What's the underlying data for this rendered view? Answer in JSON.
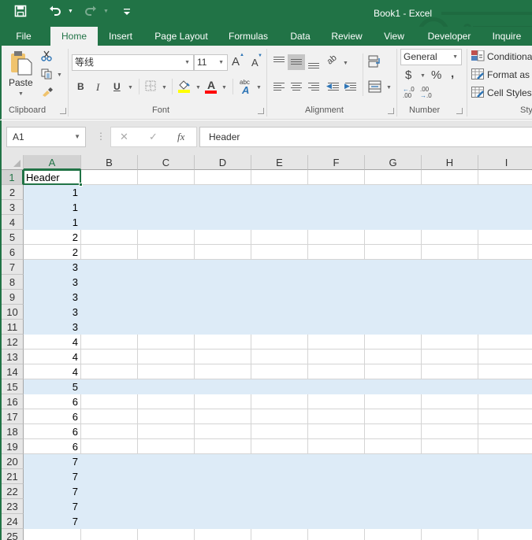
{
  "titlebar": {
    "title": "Book1 - Excel",
    "qat": [
      {
        "name": "save-icon",
        "glyph": "💾"
      },
      {
        "name": "undo-icon",
        "glyph": "↶"
      },
      {
        "name": "redo-icon",
        "glyph": "↷"
      },
      {
        "name": "customize-qat-icon",
        "glyph": "≡"
      }
    ]
  },
  "tabs": [
    {
      "label": "File",
      "active": false
    },
    {
      "label": "Home",
      "active": true
    },
    {
      "label": "Insert",
      "active": false
    },
    {
      "label": "Page Layout",
      "active": false
    },
    {
      "label": "Formulas",
      "active": false
    },
    {
      "label": "Data",
      "active": false
    },
    {
      "label": "Review",
      "active": false
    },
    {
      "label": "View",
      "active": false
    },
    {
      "label": "Developer",
      "active": false
    },
    {
      "label": "Inquire",
      "active": false
    }
  ],
  "ribbon": {
    "clipboard": {
      "label": "Clipboard",
      "paste_label": "Paste",
      "cut_icon": "scissors-icon",
      "copy_icon": "copy-icon",
      "format_painter_icon": "format-painter-icon"
    },
    "font": {
      "label": "Font",
      "font_name": "等线",
      "font_size": "11",
      "grow_label": "A",
      "shrink_label": "A",
      "bold": "B",
      "italic": "I",
      "underline": "U",
      "fill_color": "#ffff00",
      "font_color": "#ff0000",
      "font_color_label": "A",
      "phonetic_label": "abc"
    },
    "alignment": {
      "label": "Alignment",
      "middle_align_active": true
    },
    "number": {
      "label": "Number",
      "format": "General",
      "currency": "$",
      "percent": "%",
      "comma": ",",
      "increase_decimal": "←.0 .00",
      "decrease_decimal": ".00 →.0"
    },
    "styles": {
      "label": "Sty",
      "conditional": "Conditiona",
      "format_as_table": "Format as T",
      "cell_styles": "Cell Styles"
    }
  },
  "formula_bar": {
    "name_box": "A1",
    "cancel": "✕",
    "enter": "✓",
    "fx": "fx",
    "value": "Header"
  },
  "sheet": {
    "columns": [
      "A",
      "B",
      "C",
      "D",
      "E",
      "F",
      "G",
      "H",
      "I"
    ],
    "selected_column": "A",
    "selected_row": 1,
    "active_cell": "A1",
    "shade_color": "#ddebf7",
    "rows": [
      {
        "n": "1",
        "a": "Header",
        "shaded": false
      },
      {
        "n": "2",
        "a": "1",
        "shaded": true
      },
      {
        "n": "3",
        "a": "1",
        "shaded": true
      },
      {
        "n": "4",
        "a": "1",
        "shaded": true
      },
      {
        "n": "5",
        "a": "2",
        "shaded": false
      },
      {
        "n": "6",
        "a": "2",
        "shaded": false
      },
      {
        "n": "7",
        "a": "3",
        "shaded": true
      },
      {
        "n": "8",
        "a": "3",
        "shaded": true
      },
      {
        "n": "9",
        "a": "3",
        "shaded": true
      },
      {
        "n": "10",
        "a": "3",
        "shaded": true
      },
      {
        "n": "11",
        "a": "3",
        "shaded": true
      },
      {
        "n": "12",
        "a": "4",
        "shaded": false
      },
      {
        "n": "13",
        "a": "4",
        "shaded": false
      },
      {
        "n": "14",
        "a": "4",
        "shaded": false
      },
      {
        "n": "15",
        "a": "5",
        "shaded": true
      },
      {
        "n": "16",
        "a": "6",
        "shaded": false
      },
      {
        "n": "17",
        "a": "6",
        "shaded": false
      },
      {
        "n": "18",
        "a": "6",
        "shaded": false
      },
      {
        "n": "19",
        "a": "6",
        "shaded": false
      },
      {
        "n": "20",
        "a": "7",
        "shaded": true
      },
      {
        "n": "21",
        "a": "7",
        "shaded": true
      },
      {
        "n": "22",
        "a": "7",
        "shaded": true
      },
      {
        "n": "23",
        "a": "7",
        "shaded": true
      },
      {
        "n": "24",
        "a": "7",
        "shaded": true
      },
      {
        "n": "25",
        "a": "",
        "shaded": false
      }
    ]
  }
}
